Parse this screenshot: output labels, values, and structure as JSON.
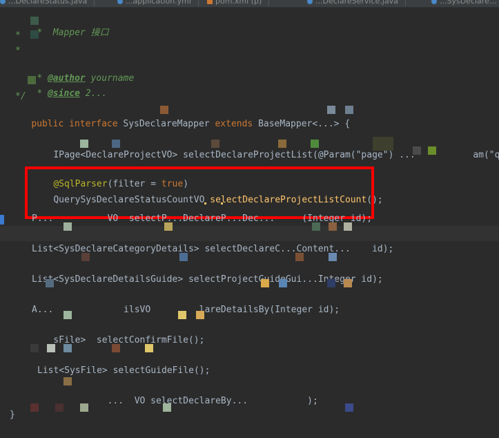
{
  "tabs": [
    {
      "label": "...DeclareStatus.java",
      "kind": "java"
    },
    {
      "label": "...application.yml",
      "kind": "yml"
    },
    {
      "label": "pom.xml (p)",
      "kind": "xml"
    },
    {
      "label": "...DeclareService.java",
      "kind": "java"
    },
    {
      "label": "...SysDeclare...",
      "kind": "java"
    }
  ],
  "code": {
    "comment_mapper_label": "Mapper 接口",
    "comment_star": "*",
    "comment_author_tag": "@author",
    "comment_author_value": " yourname",
    "comment_since_tag": "@since",
    "comment_since_value": " 2...",
    "comment_end": "*/",
    "kw_public": "public",
    "kw_interface": "interface",
    "iface_name": "SysDeclareMapper",
    "kw_extends": "extends",
    "base_type": "BaseMapper<...>",
    "brace_open": "{",
    "line_select_list": "IPage<DeclareProjectVO> selectDeclareProjectList(@Param(\"page\") ...",
    "line_select_list_tail": "am(\"query",
    "annotation": "@SqlParser",
    "annotation_args_open": "(filter = ",
    "annotation_true": "true",
    "annotation_args_close": ")",
    "count_return_type": "QuerySysDeclareStatusCountVO ",
    "count_method": "selectDeclareProjectListCount",
    "count_tail": "();",
    "line_p": "P...          VO  selectP...DeclareP...Dec...     (Integer id);",
    "line_list1": "List<SysDeclareCategoryDetails> selectDeclareC...Content...    id);",
    "line_list2": "List<SysDeclareDetailsGuide> selectProjectGuideGui...Integer id);",
    "line_a": "A...             ilsVO         lareDetailsBy(Integer id);",
    "line_file1": "    sFile>  selectConfirmFile();",
    "line_file2": "List<SysFile> selectGuideFile();",
    "line_vo": "              ...  VO selectDeclareBy...           );",
    "brace_close": "}"
  },
  "highlight": {
    "box_color": "#ff0000",
    "bg": "#2b2b2b",
    "keyword_color": "#cc7832",
    "method_color": "#ffc66d",
    "comment_color": "#629755",
    "annotation_color": "#bbb529"
  }
}
